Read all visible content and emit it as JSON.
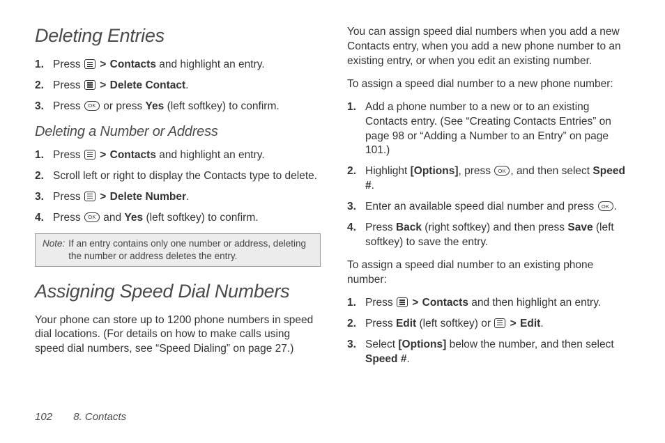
{
  "left": {
    "h1a": "Deleting Entries",
    "l1": {
      "i1_pre": "Press ",
      "i1_contacts": "Contacts",
      "i1_post": " and highlight an entry.",
      "i2_pre": "Press ",
      "i2_del": "Delete Contact",
      "i3_pre": "Press ",
      "i3_mid": " or press ",
      "i3_yes": "Yes",
      "i3_post": " (left softkey) to confirm."
    },
    "h2": "Deleting a Number or Address",
    "l2": {
      "i1_pre": "Press ",
      "i1_contacts": "Contacts",
      "i1_post": " and highlight an entry.",
      "i2": "Scroll left or right to display the Contacts type to delete.",
      "i3_pre": "Press ",
      "i3_del": "Delete Number",
      "i4_pre": "Press ",
      "i4_mid": " and ",
      "i4_yes": "Yes",
      "i4_post": " (left softkey) to confirm."
    },
    "note_label": "Note:",
    "note_text": "If an entry contains only one number or address, deleting the number or address deletes the entry.",
    "h1b": "Assigning Speed Dial Numbers",
    "p1": "Your phone can store up to 1200 phone numbers in speed dial locations. (For details on how to make calls using speed dial numbers, see “Speed Dialing” on page 27.)"
  },
  "right": {
    "p1": "You can assign speed dial numbers when you add a new Contacts entry, when you add a new phone number to an existing entry, or when you edit an existing number.",
    "p2": "To assign a speed dial number to a new phone number:",
    "l1": {
      "i1": "Add a phone number to a new or to an existing Contacts entry. (See “Creating Contacts Entries” on page 98 or “Adding a Number to an Entry” on page 101.)",
      "i2_pre": "Highlight ",
      "i2_opt": "[Options]",
      "i2_mid": ", press ",
      "i2_mid2": ", and then select ",
      "i2_speed": "Speed #",
      "i3_pre": "Enter an available speed dial number and press ",
      "i4_pre": "Press ",
      "i4_back": "Back",
      "i4_mid": " (right softkey) and then press ",
      "i4_save": "Save",
      "i4_post": " (left softkey) to save the entry."
    },
    "p3": "To assign a speed dial number to an existing phone number:",
    "l2": {
      "i1_pre": "Press ",
      "i1_contacts": "Contacts",
      "i1_post": " and then highlight an entry.",
      "i2_pre": "Press ",
      "i2_edit": "Edit",
      "i2_mid": " (left softkey) or ",
      "i2_edit2": "Edit",
      "i3_pre": "Select ",
      "i3_opt": "[Options]",
      "i3_mid": " below the number, and then select ",
      "i3_speed": "Speed #"
    }
  },
  "gt": ">",
  "dot": ".",
  "footer": {
    "page": "102",
    "chapter": "8. Contacts"
  }
}
